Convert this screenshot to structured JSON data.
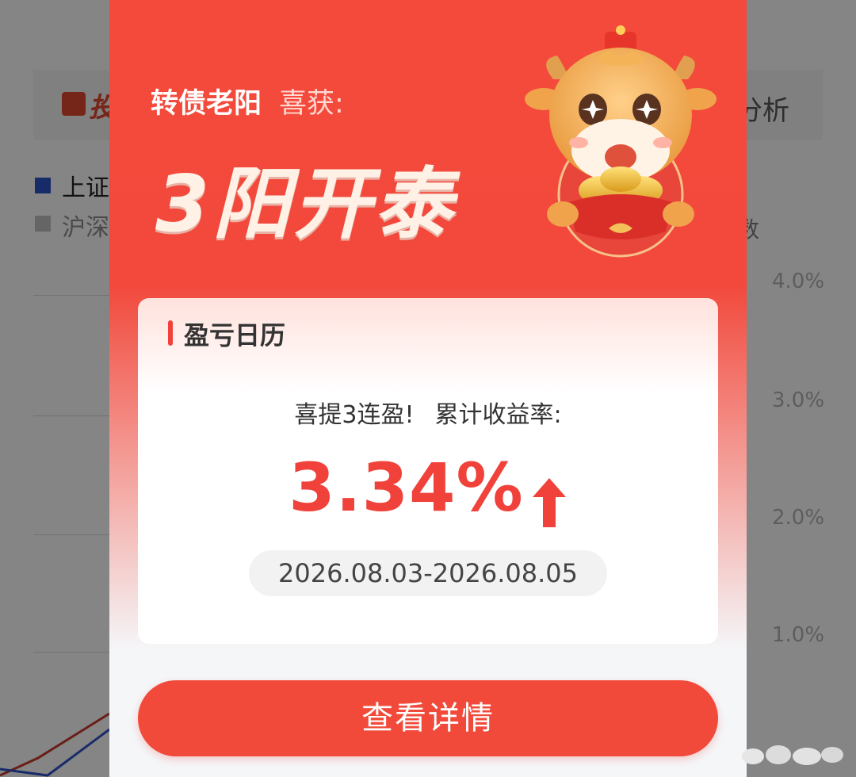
{
  "background": {
    "tab_left_text": "投",
    "tab_right_text": "分析",
    "legend": [
      {
        "label": "上证",
        "color": "#2c4fc0"
      },
      {
        "label": "沪深",
        "color": "#b9b9b9"
      }
    ],
    "legend_right_text": "数",
    "y_axis_labels": [
      "4.0%",
      "3.0%",
      "2.0%",
      "1.0%"
    ]
  },
  "modal": {
    "user_name": "转债老阳",
    "header_suffix": "喜获:",
    "title": "3阳开泰",
    "card": {
      "title": "盈亏日历",
      "subtitle_streak": "喜提3连盈!",
      "subtitle_label": "累计收益率:",
      "rate": "3.34%",
      "date_range": "2026.08.03-2026.08.05"
    },
    "button_label": "查看详情"
  },
  "colors": {
    "accent_red": "#f0423a",
    "modal_red": "#f44a3c",
    "overlay": "rgba(0,0,0,0.45)"
  }
}
